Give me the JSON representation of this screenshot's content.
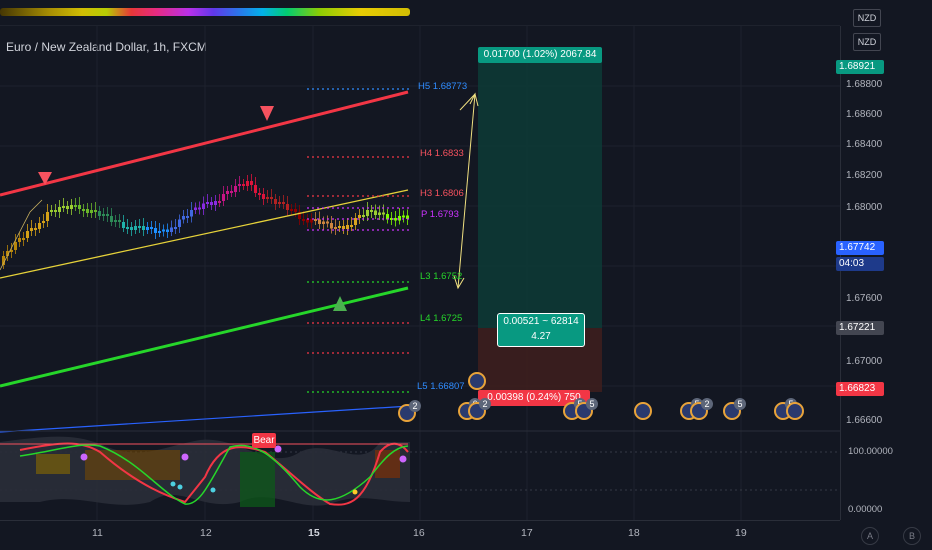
{
  "header": {
    "symbol_title": "Euro / New Zealand Dollar, 1h, FXCM"
  },
  "axis": {
    "currency_top": "NZD",
    "currency": "NZD",
    "price_ticks": [
      "1.68800",
      "1.68600",
      "1.68400",
      "1.68200",
      "1.68000",
      "1.67600",
      "1.67400",
      "1.67000",
      "1.66600"
    ],
    "time_ticks": [
      "11",
      "12",
      "15",
      "16",
      "17",
      "18",
      "19"
    ]
  },
  "price_tags": {
    "top": "1.68921",
    "last": "1.67742",
    "countdown": "04:03",
    "mid": "1.67221",
    "low": "1.66823"
  },
  "levels": {
    "h5": "H5 1.68773",
    "h4": "H4 1.6833",
    "h3": "H3 1.6806",
    "p": "P 1.6793",
    "l3": "L3 1.6752",
    "l4": "L4 1.6725",
    "l5": "L5 1.66807"
  },
  "position": {
    "target": "0.01700 (1.02%) 2067.84",
    "ratio_line1": "0.00521 ~ 62814",
    "ratio_line2": "4.27",
    "stop": "0.00398 (0.24%) 750"
  },
  "events": [
    {
      "badge": "2"
    },
    {
      "badge": "6"
    },
    {
      "badge": "2"
    },
    {
      "badge": "5"
    },
    {
      "badge": "5"
    },
    {
      "badge": ""
    },
    {
      "badge": "5"
    },
    {
      "badge": "2"
    },
    {
      "badge": "5"
    },
    {
      "badge": "5"
    },
    {
      "badge": ""
    }
  ],
  "oscillator": {
    "signal": "Bear",
    "upper_value": "100.00000",
    "lower_value": "0.00000"
  },
  "corner_buttons": {
    "auto": "A",
    "log": "B"
  },
  "colors": {
    "background": "#131722",
    "upper_channel": "#f23645",
    "lower_channel": "#26d62a",
    "mid_channel": "#e6d23a",
    "target_zone": "#0d3b36",
    "stop_zone": "#3d1e1e",
    "target_label": "#089981",
    "stop_label": "#f23645"
  }
}
